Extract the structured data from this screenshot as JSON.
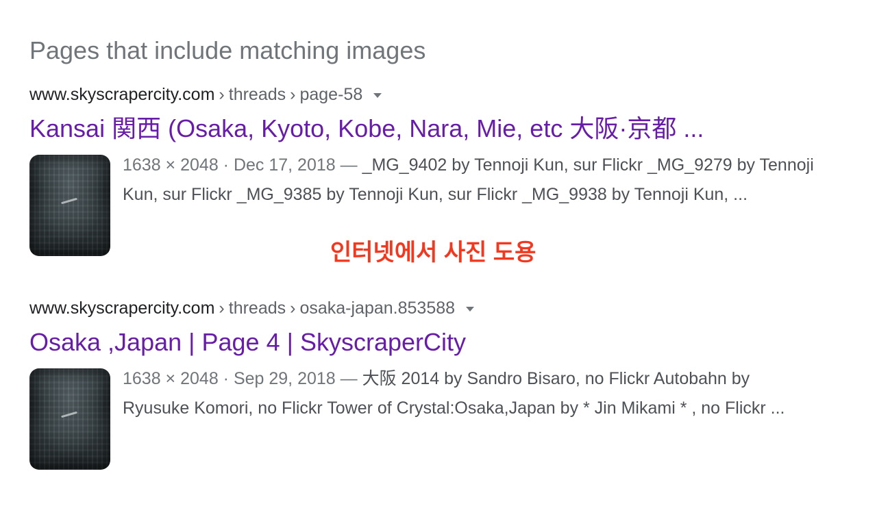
{
  "section": {
    "title": "Pages that include matching images"
  },
  "results": [
    {
      "breadcrumb": {
        "site": "www.skyscrapercity.com",
        "separator": "›",
        "path_1": "threads",
        "path_2": "page-58"
      },
      "title": "Kansai 関西 (Osaka, Kyoto, Kobe, Nara, Mie, etc 大阪·京都 ...",
      "meta": "1638 × 2048 · Dec 17, 2018",
      "dash": "—",
      "snippet": "_MG_9402 by Tennoji Kun, sur Flickr _MG_9279 by Tennoji Kun, sur Flickr _MG_9385 by Tennoji Kun, sur Flickr _MG_9938 by Tennoji Kun, ..."
    },
    {
      "breadcrumb": {
        "site": "www.skyscrapercity.com",
        "separator": "›",
        "path_1": "threads",
        "path_2": "osaka-japan.853588"
      },
      "title": "Osaka ,Japan | Page 4 | SkyscraperCity",
      "meta": "1638 × 2048 · Sep 29, 2018",
      "dash": "—",
      "snippet": "大阪 2014 by Sandro Bisaro, no Flickr Autobahn by Ryusuke Komori, no Flickr Tower of Crystal:Osaka,Japan by  * Jin Mikami * , no Flickr ..."
    }
  ],
  "overlay": {
    "text": "인터넷에서 사진 도용",
    "color": "#f2381e"
  },
  "colors": {
    "visited_link": "#681da8",
    "section_title": "#70757a",
    "snippet_text": "#4d5156"
  }
}
